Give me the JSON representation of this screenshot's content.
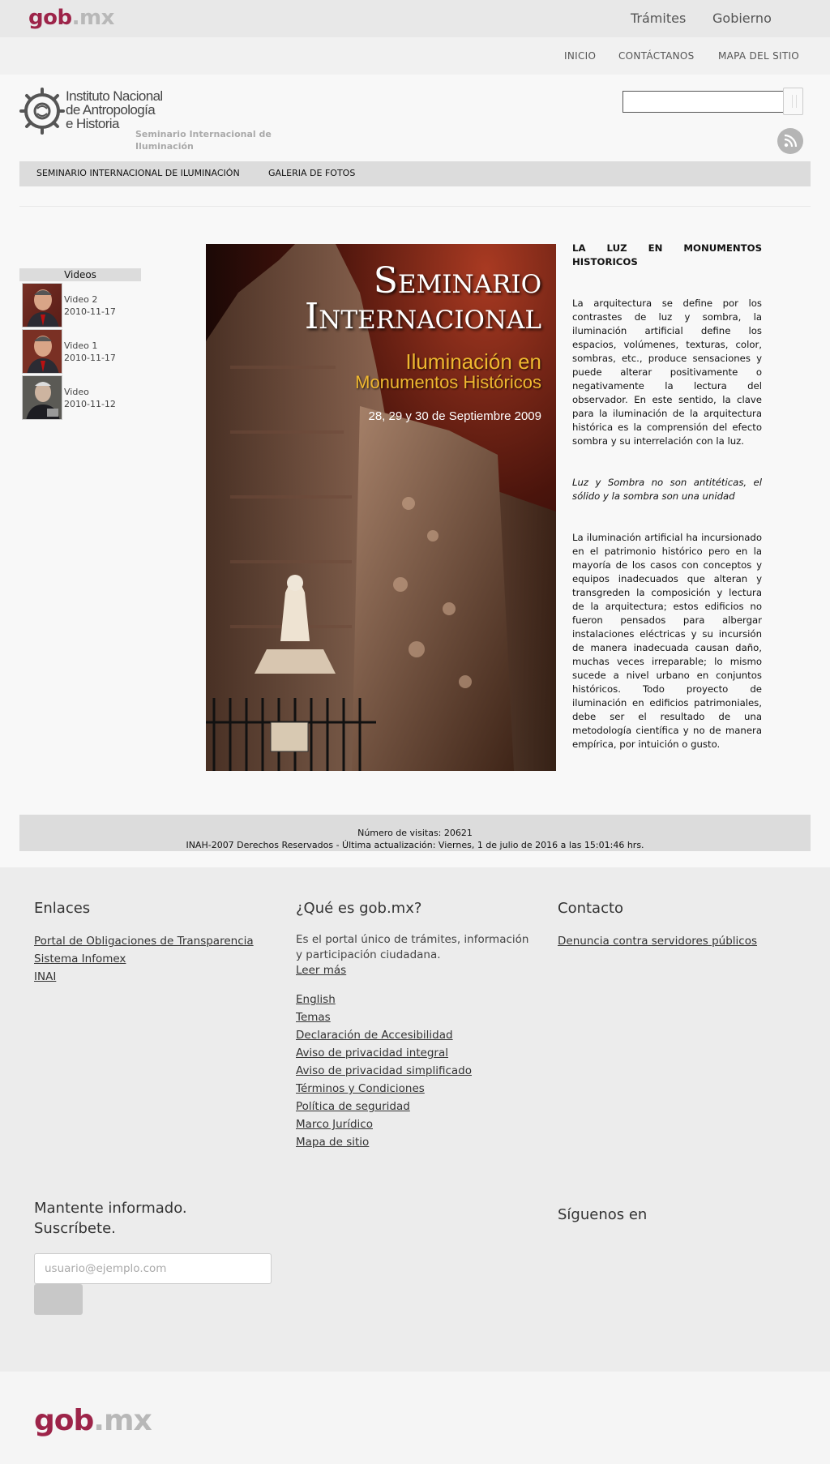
{
  "topbar": {
    "logo_gob": "gob",
    "logo_mx": ".mx",
    "tramites": "Trámites",
    "gobierno": "Gobierno"
  },
  "subnav": {
    "inicio": "INICIO",
    "contacto": "CONTÁCTANOS",
    "mapa": "MAPA DEL SITIO"
  },
  "header": {
    "inah_line1": "Instituto Nacional",
    "inah_line2": "de Antropología",
    "inah_line3": "e Historia",
    "site_subtitle": "Seminario Internacional de Iluminación"
  },
  "menu": {
    "item1": "SEMINARIO INTERNACIONAL DE ILUMINACIÓN",
    "item2": "GALERIA DE FOTOS"
  },
  "videos": {
    "header": "Videos",
    "items": [
      {
        "title": "Video 2",
        "date": "2010-11-17"
      },
      {
        "title": "Video 1",
        "date": "2010-11-17"
      },
      {
        "title": "Video",
        "date": "2010-11-12"
      }
    ]
  },
  "poster": {
    "title1": "Seminario",
    "title2": "Internacional",
    "sub1": "Iluminación en",
    "sub2": "Monumentos Históricos",
    "dates": "28, 29 y 30 de Septiembre 2009"
  },
  "article": {
    "heading": "LA LUZ EN MONUMENTOS HISTORICOS",
    "p1": "La arquitectura se define por los contrastes de luz y sombra, la iluminación artificial define los espacios, volúmenes, texturas, color, sombras, etc., produce sensaciones y puede alterar positivamente o negativamente la lectura del observador. En este sentido, la clave para la iluminación de la arquitectura histórica es la comprensión del efecto sombra y su interrelación con la luz.",
    "quote": "Luz y Sombra no son antitéticas, el sólido y la sombra son una unidad",
    "p2": "La iluminación artificial ha incursionado en el patrimonio histórico pero en la mayoría de los casos con conceptos y equipos inadecuados que alteran y transgreden la composición y lectura de la arquitectura; estos edificios no fueron pensados para albergar instalaciones eléctricas y su incursión de manera inadecuada causan daño, muchas veces irreparable; lo mismo sucede a nivel urbano en conjuntos históricos. Todo proyecto de iluminación en edificios patrimoniales, debe ser el resultado de una metodología científica y no de manera empírica, por intuición o gusto."
  },
  "stats": {
    "visits": "Número de visitas: 20621",
    "rights": "INAH-2007 Derechos Reservados -  Última actualización: Viernes, 1 de julio de 2016 a las 15:01:46 hrs."
  },
  "footer": {
    "enlaces_title": "Enlaces",
    "enlaces": [
      "Portal de Obligaciones de Transparencia",
      "Sistema Infomex",
      "INAI"
    ],
    "que_es_title": "¿Qué es gob.mx?",
    "que_es_desc": "Es el portal único de trámites, información y participación ciudadana.",
    "leer_mas": "Leer más",
    "more_links": [
      "English",
      "Temas",
      "Declaración de Accesibilidad",
      "Aviso de privacidad integral",
      "Aviso de privacidad simplificado",
      "Términos y Condiciones",
      "Política de seguridad",
      "Marco Jurídico",
      "Mapa de sitio"
    ],
    "contacto_title": "Contacto",
    "denuncia": "Denuncia contra servidores públicos",
    "mantente_line1": "Mantente informado.",
    "mantente_line2": "Suscríbete.",
    "email_placeholder": "usuario@ejemplo.com",
    "siguenos": "Síguenos en"
  },
  "bottom": {
    "logo_gob": "gob",
    "logo_mx": ".mx"
  },
  "colors": {
    "brand": "#9d2449",
    "logo_gray": "#b8b8b8",
    "menu_bg": "#dcdcdc"
  }
}
